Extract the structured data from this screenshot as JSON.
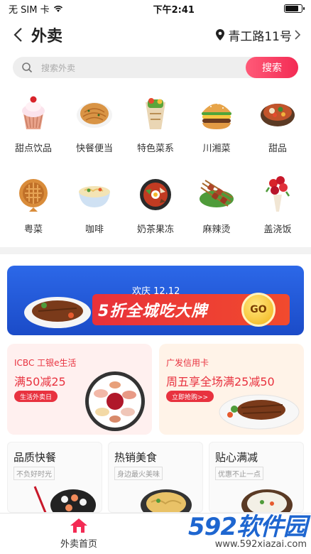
{
  "status": {
    "carrier": "无 SIM 卡",
    "time": "下午2:41"
  },
  "header": {
    "title": "外卖",
    "location": "青工路11号"
  },
  "search": {
    "placeholder": "搜索外卖",
    "button": "搜索"
  },
  "categories": [
    {
      "label": "甜点饮品",
      "icon": "cupcake-icon"
    },
    {
      "label": "快餐便当",
      "icon": "pancake-icon"
    },
    {
      "label": "特色菜系",
      "icon": "wrap-icon"
    },
    {
      "label": "川湘菜",
      "icon": "burger-icon"
    },
    {
      "label": "甜品",
      "icon": "hotpot-icon"
    },
    {
      "label": "粤菜",
      "icon": "waffle-icon"
    },
    {
      "label": "咖啡",
      "icon": "noodle-bowl-icon"
    },
    {
      "label": "奶茶果冻",
      "icon": "bibimbap-icon"
    },
    {
      "label": "麻辣烫",
      "icon": "skewers-icon"
    },
    {
      "label": "盖浇饭",
      "icon": "flowers-icon"
    }
  ],
  "banner": {
    "subtitle": "欢庆 12.12",
    "headline": "5折全城吃大牌",
    "go": "GO"
  },
  "promos": [
    {
      "tag": "ICBC 工银e生活",
      "title": "满50减25",
      "button": "生活外卖日"
    },
    {
      "tag": "广发信用卡",
      "title": "周五享全场满25减50",
      "button": "立即抢购>>"
    }
  ],
  "sections": [
    {
      "title": "品质快餐",
      "sub": "不负好时光"
    },
    {
      "title": "热销美食",
      "sub": "身边最火美味"
    },
    {
      "title": "贴心满减",
      "sub": "优惠不止一点"
    }
  ],
  "tabbar": {
    "home": "外卖首页"
  },
  "watermark": {
    "logo": "592软件园",
    "url": "www.592xiazai.com"
  },
  "colors": {
    "accent": "#f32b54",
    "promo_red": "#e8323f",
    "banner_blue": "#2c68e8"
  }
}
